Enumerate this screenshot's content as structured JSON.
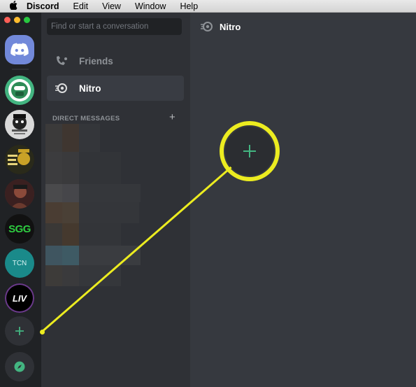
{
  "menubar": {
    "apple_icon": "apple-logo",
    "items": [
      "Discord",
      "Edit",
      "View",
      "Window",
      "Help"
    ]
  },
  "guild_bar": {
    "servers": [
      {
        "name": "discord-home",
        "color": "#7289da"
      },
      {
        "name": "server-green-avatar",
        "color": "#43b581"
      },
      {
        "name": "server-dog-avatar",
        "color": "#d9d9d9"
      },
      {
        "name": "server-writer-avatar",
        "color": "#1a1a1a"
      },
      {
        "name": "server-portrait-avatar",
        "color": "#5a2e2e"
      },
      {
        "name": "server-sgg",
        "label": "SGG",
        "color": "#111111"
      },
      {
        "name": "server-tcn",
        "label": "TCN",
        "color": "#1a8a8a"
      },
      {
        "name": "server-liv",
        "label": "LIV",
        "color": "#000000"
      }
    ],
    "add_server_icon": "plus-icon",
    "explore_icon": "compass-icon"
  },
  "channels": {
    "search_placeholder": "Find or start a conversation",
    "nav": [
      {
        "label": "Friends",
        "icon": "friends-icon"
      },
      {
        "label": "Nitro",
        "icon": "nitro-icon"
      }
    ],
    "dm_header": "DIRECT MESSAGES",
    "dm_add": "+"
  },
  "main": {
    "title": "Nitro"
  },
  "annotation": {
    "highlight_color": "#ecec20",
    "plus_color": "#43b581"
  }
}
